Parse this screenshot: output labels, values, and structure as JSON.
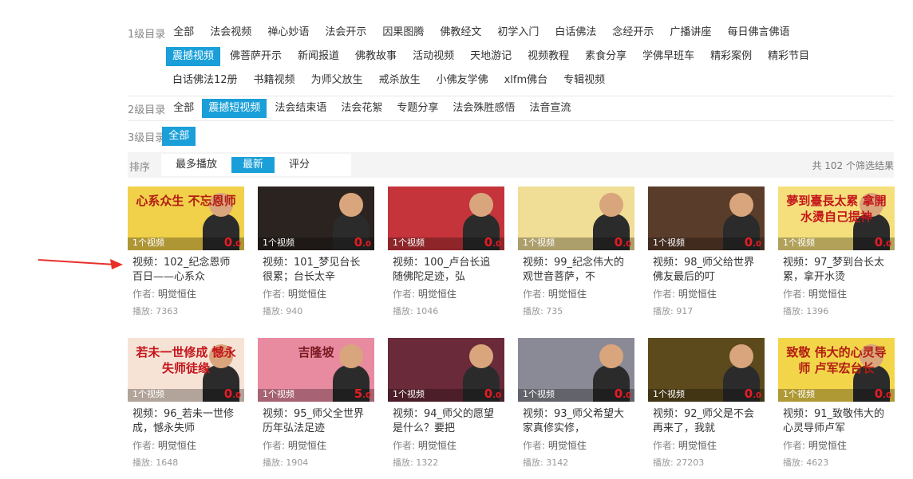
{
  "filters": {
    "level1": {
      "label": "1级目录",
      "items": [
        "全部",
        "法会视频",
        "禅心妙语",
        "法会开示",
        "因果图腾",
        "佛教经文",
        "初学入门",
        "白话佛法",
        "念经开示",
        "广播讲座",
        "每日佛言佛语",
        "震撼视频",
        "佛菩萨开示",
        "新闻报道",
        "佛教故事",
        "活动视频",
        "天地游记",
        "视频教程",
        "素食分享",
        "学佛早班车",
        "精彩案例",
        "精彩节目",
        "白话佛法12册",
        "书籍视频",
        "为师父放生",
        "戒杀放生",
        "小佛友学佛",
        "xlfm佛台",
        "专辑视频"
      ],
      "active": "震撼视频"
    },
    "level2": {
      "label": "2级目录",
      "items": [
        "全部",
        "震撼短视频",
        "法会结束语",
        "法会花絮",
        "专题分享",
        "法会殊胜感悟",
        "法音宣流"
      ],
      "active": "震撼短视频"
    },
    "level3": {
      "label": "3级目录",
      "items": [
        "全部"
      ],
      "active": "全部"
    }
  },
  "sort": {
    "label": "排序",
    "options": [
      "最多播放",
      "最新",
      "评分"
    ],
    "active": "最新",
    "total": "共 102 个筛选结果"
  },
  "videos": [
    {
      "title": "视频：102_纪念恩师百日——心系众",
      "author_label": "作者:",
      "author": "明觉恒住",
      "plays": "播放: 7363",
      "count": "1个视频",
      "score_int": "0",
      "score_dec": ".0",
      "thumb_text": "心系众生 不忘恩师",
      "bg": "#f1d04a",
      "fg": "#b21d12"
    },
    {
      "title": "视频：101_梦见台长很累；台长太辛",
      "author_label": "作者:",
      "author": "明觉恒住",
      "plays": "播放: 940",
      "count": "1个视频",
      "score_int": "0",
      "score_dec": ".0",
      "thumb_text": "",
      "bg": "#2a2320",
      "fg": "#f4d33b"
    },
    {
      "title": "视频：100_卢台长追随佛陀足迹，弘",
      "author_label": "作者:",
      "author": "明觉恒住",
      "plays": "播放: 1046",
      "count": "1个视频",
      "score_int": "0",
      "score_dec": ".0",
      "thumb_text": "",
      "bg": "#c4343a",
      "fg": "#ffe07a"
    },
    {
      "title": "视频：99_纪念伟大的观世音菩萨，不",
      "author_label": "作者:",
      "author": "明觉恒住",
      "plays": "播放: 735",
      "count": "1个视频",
      "score_int": "0",
      "score_dec": ".0",
      "thumb_text": "",
      "bg": "#f0dd96",
      "fg": "#6b4a1a"
    },
    {
      "title": "视频：98_师父给世界佛友最后的叮",
      "author_label": "作者:",
      "author": "明觉恒住",
      "plays": "播放: 917",
      "count": "1个视频",
      "score_int": "0",
      "score_dec": ".0",
      "thumb_text": "",
      "bg": "#5a3c2a",
      "fg": "#ffd27a"
    },
    {
      "title": "视频：97_梦到台长太累，拿开水烫",
      "author_label": "作者:",
      "author": "明觉恒住",
      "plays": "播放: 1396",
      "count": "1个视频",
      "score_int": "0",
      "score_dec": ".0",
      "thumb_text": "夢到臺長太累 拿開水燙自己提神",
      "bg": "#f5df7c",
      "fg": "#c4161c"
    },
    {
      "title": "视频：96_若未一世修成，憾永失师",
      "author_label": "作者:",
      "author": "明觉恒住",
      "plays": "播放: 1648",
      "count": "1个视频",
      "score_int": "0",
      "score_dec": ".0",
      "thumb_text": "若未一世修成 憾永失师徒缘",
      "bg": "#f7e3d6",
      "fg": "#c4161c"
    },
    {
      "title": "视频：95_师父全世界历年弘法足迹",
      "author_label": "作者:",
      "author": "明觉恒住",
      "plays": "播放: 1904",
      "count": "1个视频",
      "score_int": "5",
      "score_dec": ".0",
      "thumb_text": "吉隆坡",
      "bg": "#e88aa0",
      "fg": "#7a1a22"
    },
    {
      "title": "视频：94_师父的愿望是什么？要把",
      "author_label": "作者:",
      "author": "明觉恒住",
      "plays": "播放: 1322",
      "count": "1个视频",
      "score_int": "0",
      "score_dec": ".0",
      "thumb_text": "",
      "bg": "#6a2a3a",
      "fg": "#ffffff"
    },
    {
      "title": "视频：93_师父希望大家真修实修，",
      "author_label": "作者:",
      "author": "明觉恒住",
      "plays": "播放: 3142",
      "count": "1个视频",
      "score_int": "0",
      "score_dec": ".0",
      "thumb_text": "",
      "bg": "#8a8a96",
      "fg": "#ffffff"
    },
    {
      "title": "视频：92_师父是不会再来了，我就",
      "author_label": "作者:",
      "author": "明觉恒住",
      "plays": "播放: 27203",
      "count": "1个视频",
      "score_int": "0",
      "score_dec": ".0",
      "thumb_text": "",
      "bg": "#5c4a1c",
      "fg": "#ffd23a"
    },
    {
      "title": "视频：91_致敬伟大的心灵导师卢军",
      "author_label": "作者:",
      "author": "明觉恒住",
      "plays": "播放: 4623",
      "count": "1个视频",
      "score_int": "0",
      "score_dec": ".0",
      "thumb_text": "致敬 伟大的心灵导师 卢军宏台长",
      "bg": "#f3d54a",
      "fg": "#b21d12"
    }
  ]
}
